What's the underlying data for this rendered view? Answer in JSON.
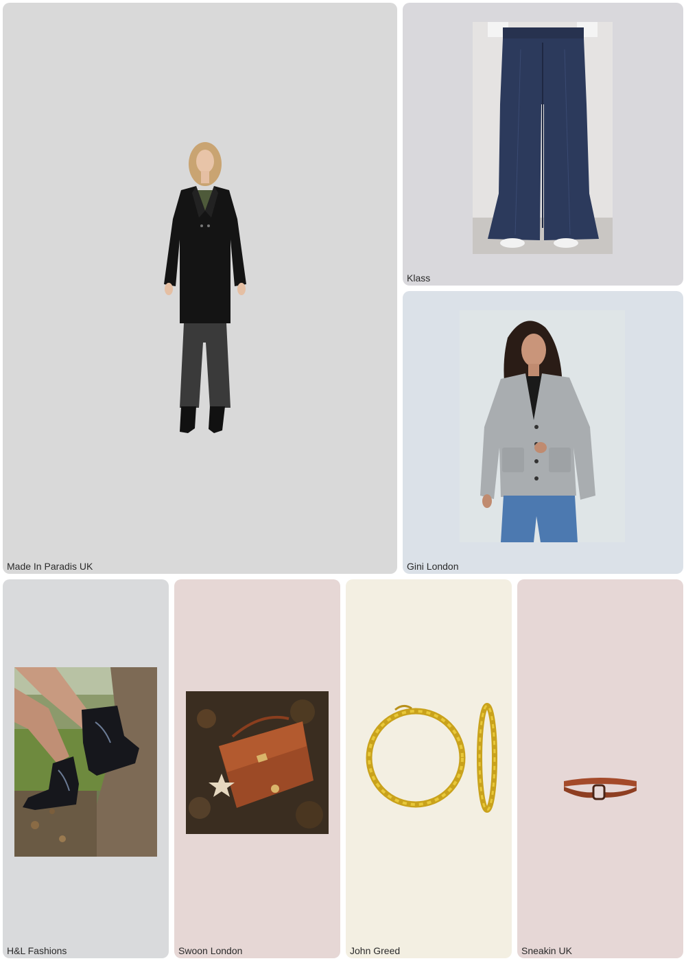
{
  "tiles": [
    {
      "brand": "Made In Paradis UK",
      "product": "black-wool-coat-outfit",
      "bg": "#d9d9d9"
    },
    {
      "brand": "Klass",
      "product": "navy-flared-trousers",
      "bg": "#d9d8dc"
    },
    {
      "brand": "Gini London",
      "product": "grey-cable-knit-cardigan",
      "bg": "#dbe1e8"
    },
    {
      "brand": "H&L Fashions",
      "product": "black-western-ankle-boots",
      "bg": "#d9dadc"
    },
    {
      "brand": "Swoon London",
      "product": "tan-leather-crossbody-bag",
      "bg": "#e6d7d5"
    },
    {
      "brand": "John Greed",
      "product": "gold-twisted-hoop-earrings",
      "bg": "#f3efe2"
    },
    {
      "brand": "Sneakin UK",
      "product": "tan-leather-belt",
      "bg": "#e6d7d6"
    }
  ]
}
